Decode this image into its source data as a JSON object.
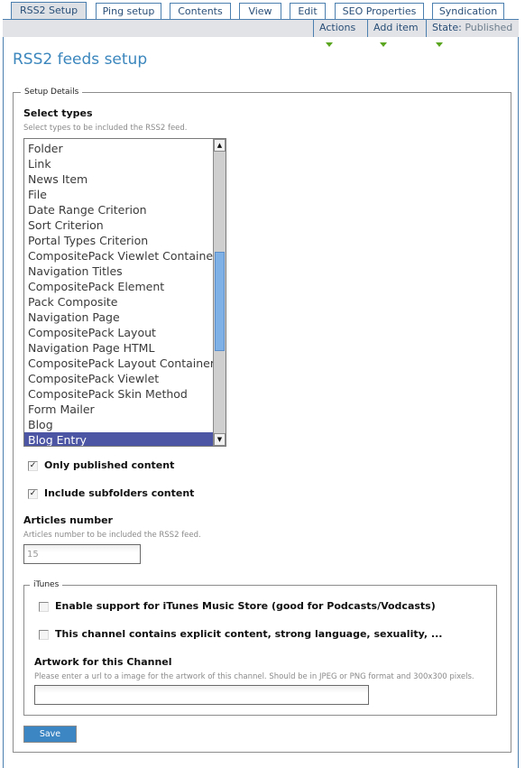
{
  "tabs": [
    {
      "label": "RSS2 Setup",
      "active": true
    },
    {
      "label": "Ping setup",
      "active": false
    },
    {
      "label": "Contents",
      "active": false
    },
    {
      "label": "View",
      "active": false
    },
    {
      "label": "Edit",
      "active": false
    },
    {
      "label": "SEO Properties",
      "active": false
    },
    {
      "label": "Syndication",
      "active": false
    }
  ],
  "menus": {
    "actions": "Actions",
    "add_item": "Add item",
    "state_prefix": "State:",
    "state_value": "Published"
  },
  "colors": {
    "accent": "#3a86bd",
    "tab_border": "#4a7fb0",
    "menu_arrow": "#5aa620",
    "selected_option": "#4b55a3",
    "save_button": "#3c86c4"
  },
  "page_title": "RSS2 feeds setup",
  "setup_details": {
    "legend": "Setup Details",
    "select_types": {
      "label": "Select types",
      "help": "Select types to be included the RSS2 feed.",
      "options": [
        "Folder",
        "Link",
        "News Item",
        "File",
        "Date Range Criterion",
        "Sort Criterion",
        "Portal Types Criterion",
        "CompositePack Viewlet Container",
        "Navigation Titles",
        "CompositePack Element",
        "Pack Composite",
        "Navigation Page",
        "CompositePack Layout",
        "Navigation Page HTML",
        "CompositePack Layout Container",
        "CompositePack Viewlet",
        "CompositePack Skin Method",
        "Form Mailer",
        "Blog",
        "Blog Entry"
      ],
      "selected": "Blog Entry",
      "scroll_position_fraction": 0.55
    },
    "only_published": {
      "label": "Only published content",
      "checked": true
    },
    "include_subfolders": {
      "label": "Include subfolders content",
      "checked": true
    },
    "articles_number": {
      "label": "Articles number",
      "help": "Articles number to be included the RSS2 feed.",
      "value": "15"
    },
    "itunes": {
      "legend": "iTunes",
      "enable_support": {
        "label": "Enable support for iTunes Music Store (good for Podcasts/Vodcasts)",
        "checked": false
      },
      "explicit": {
        "label": "This channel contains explicit content, strong language, sexuality, ...",
        "checked": false
      },
      "artwork": {
        "label": "Artwork for this Channel",
        "help": "Please enter a url to a image for the artwork of this channel. Should be in JPEG or PNG format and 300x300 pixels.",
        "value": ""
      }
    },
    "save_label": "Save"
  },
  "icons": {
    "check": "✓",
    "scroll_up": "▲",
    "scroll_down": "▼"
  }
}
